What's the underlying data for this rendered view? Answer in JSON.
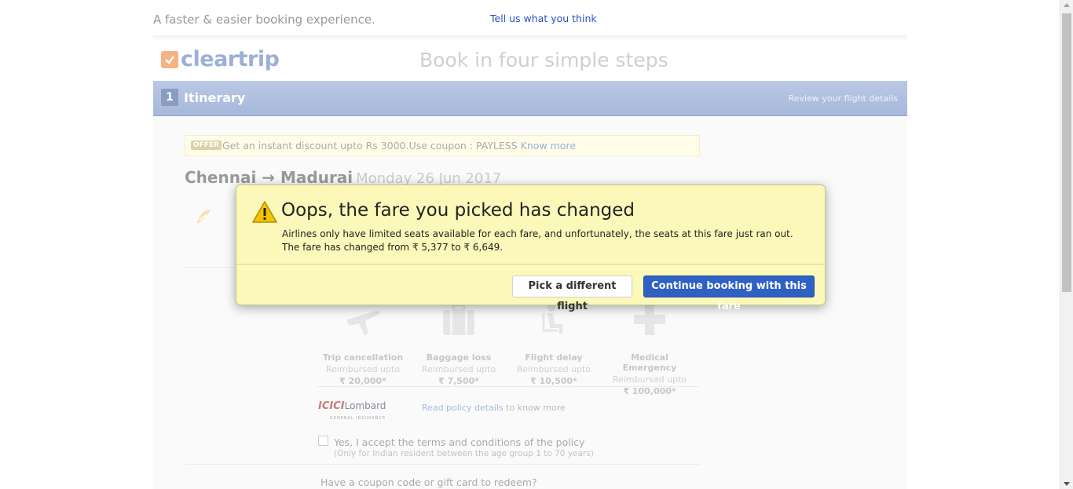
{
  "header": {
    "tagline": "A faster & easier booking experience.",
    "feedback_link": "Tell us what you think",
    "logo_text": "cleartrip",
    "steps_title": "Book in four simple steps"
  },
  "step": {
    "number": "1",
    "name": "Itinerary",
    "hint": "Review your flight details"
  },
  "offer": {
    "tag": "OFFER",
    "text": "Get an instant discount upto Rs 3000.Use coupon : PAYLESS",
    "link": "Know more"
  },
  "trip": {
    "route": "Chennai → Madurai",
    "date": "Monday 26 Jun 2017"
  },
  "insurance": {
    "items": [
      {
        "title": "Trip cancellation",
        "sub": "Reimbursed upto",
        "amount": "₹ 20,000*",
        "icon": "plane-icon"
      },
      {
        "title": "Baggage loss",
        "sub": "Reimbursed upto",
        "amount": "₹ 7,500*",
        "icon": "baggage-icon"
      },
      {
        "title": "Flight delay",
        "sub": "Reimbursed upto",
        "amount": "₹ 10,500*",
        "icon": "seated-person-icon"
      },
      {
        "title": "Medical Emergency",
        "sub": "Reimbursed upto",
        "amount": "₹ 100,000*",
        "icon": "medical-cross-icon"
      }
    ],
    "provider_name": "ICICI",
    "provider_suffix": "Lombard",
    "provider_sub": "GENERAL INSURANCE",
    "policy_link": "Read policy details",
    "policy_rest": " to know more",
    "accept_label": "Yes, I accept the terms and conditions of the policy",
    "accept_note": "(Only for Indian resident between the age group 1 to 70 years)",
    "accept_checked": false
  },
  "coupon": {
    "prompt": "Have a coupon code or gift card to redeem?"
  },
  "modal": {
    "title": "Oops, the fare you picked has changed",
    "body": "Airlines only have limited seats available for each fare, and unfortunately, the seats at this fare just ran out. The fare has changed from ₹ 5,377 to ₹ 6,649.",
    "secondary_button": "Pick a different flight",
    "primary_button": "Continue booking with this fare"
  },
  "colors": {
    "modal_bg": "#fbf8b9",
    "primary_button": "#2f61c4",
    "step_bar": "#a6b8db",
    "logo_accent": "#f4b383"
  }
}
